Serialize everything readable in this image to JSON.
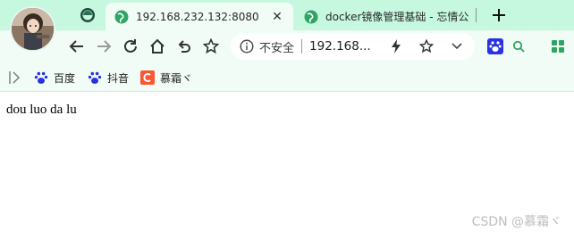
{
  "tabs": [
    {
      "title": "192.168.232.132:8080",
      "active": true
    },
    {
      "title": "docker镜像管理基础 - 忘情公",
      "active": false
    }
  ],
  "omnibox": {
    "security_text": "不安全",
    "url": "192.168...."
  },
  "bookmarks": [
    {
      "label": "百度",
      "icon": "baidu-paw-icon"
    },
    {
      "label": "抖音",
      "icon": "baidu-paw-icon"
    },
    {
      "label": "慕霜ヾ",
      "icon": "csdn-c-icon"
    }
  ],
  "page": {
    "text": "dou luo da lu",
    "watermark": "CSDN @慕霜ヾ"
  },
  "colors": {
    "tabstrip_bg": "#c6f7df",
    "toolbar_bg": "#f1fcf6",
    "favicon_green": "#2fa463",
    "csdn_red": "#fc5531",
    "baidu_blue": "#2932e1"
  }
}
